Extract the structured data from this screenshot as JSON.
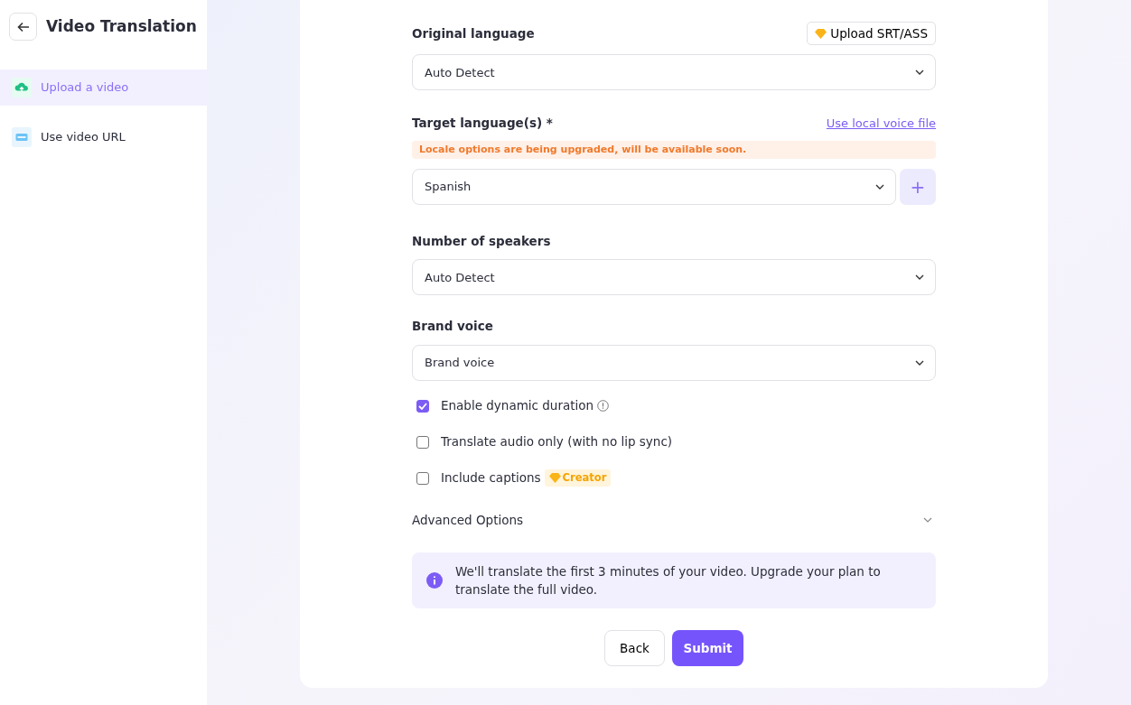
{
  "sidebar": {
    "title": "Video Translation",
    "items": [
      {
        "label": "Upload a video",
        "kind": "upload",
        "selected": true
      },
      {
        "label": "Use video URL",
        "kind": "url",
        "selected": false
      }
    ]
  },
  "form": {
    "original_language": {
      "label": "Original language",
      "action": "Upload SRT/ASS",
      "value": "Auto Detect"
    },
    "target_language": {
      "label": "Target language(s) *",
      "link": "Use local voice file",
      "notice": "Locale options are being upgraded, will be available soon.",
      "value": "Spanish",
      "add_button": "+"
    },
    "speakers": {
      "label": "Number of speakers",
      "value": "Auto Detect"
    },
    "brand_voice": {
      "label": "Brand voice",
      "value": "Brand voice"
    },
    "options": [
      {
        "label": "Enable dynamic duration",
        "checked": true,
        "info": true
      },
      {
        "label": "Translate audio only (with no lip sync)",
        "checked": false
      },
      {
        "label": "Include captions",
        "checked": false,
        "badge": "Creator"
      }
    ],
    "advanced": {
      "label": "Advanced Options",
      "expanded": false
    },
    "info": "We'll translate the first 3 minutes of your video. Upgrade your plan to translate the full video.",
    "buttons": [
      {
        "label": "Back",
        "kind": "secondary"
      },
      {
        "label": "Submit",
        "kind": "primary"
      }
    ]
  }
}
